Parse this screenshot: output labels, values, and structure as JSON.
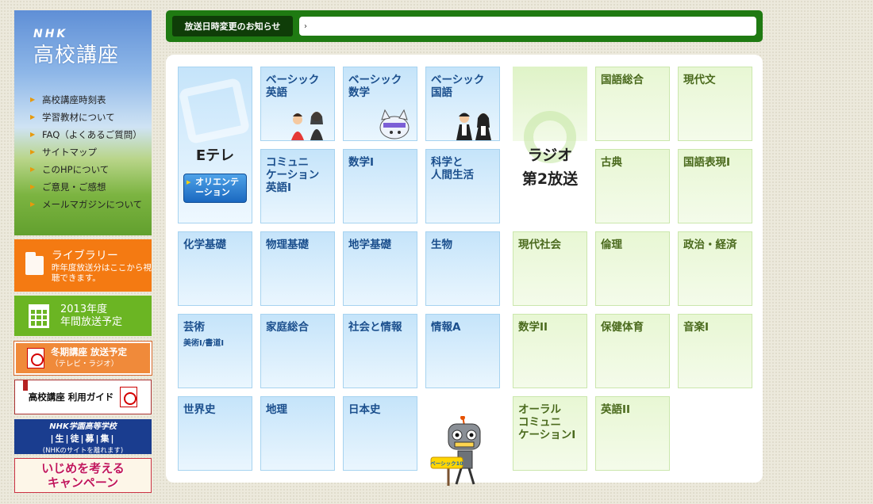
{
  "sidebar": {
    "logo_nhk": "NHK",
    "logo_title": "高校講座",
    "menu": [
      "高校講座時刻表",
      "学習教材について",
      "FAQ（よくあるご質問）",
      "サイトマップ",
      "このHPについて",
      "ご意見・ご感想",
      "メールマガジンについて"
    ],
    "library": {
      "title": "ライブラリー",
      "desc": "昨年度放送分はここから視聴できます。"
    },
    "schedule": {
      "line1": "2013年度",
      "line2": "年間放送予定"
    },
    "winter": {
      "line1": "冬期講座 放送予定",
      "line2": "（テレビ・ラジオ）"
    },
    "guide": "高校講座 利用ガイド",
    "gakuen": {
      "l1": "NHK学園高等学校",
      "l2": "|生|徒|募|集|",
      "l3": "(NHKのサイトを離れます)"
    },
    "ijime": {
      "line1": "いじめを考える",
      "line2": "キャンペーン"
    }
  },
  "notice": {
    "label": "放送日時変更のお知らせ",
    "text": "›"
  },
  "tv": {
    "title": "Eテレ",
    "orientation": "オリエンテーション",
    "tiles": [
      {
        "label": "ベーシック\n英語"
      },
      {
        "label": "ベーシック\n数学"
      },
      {
        "label": "ベーシック\n国語"
      },
      {
        "label": "コミュニ\nケーション\n英語I"
      },
      {
        "label": "数学I"
      },
      {
        "label": "科学と\n人間生活"
      },
      {
        "label": "化学基礎"
      },
      {
        "label": "物理基礎"
      },
      {
        "label": "地学基礎"
      },
      {
        "label": "生物"
      },
      {
        "label": "芸術",
        "sub": "美術I/書道I"
      },
      {
        "label": "家庭総合"
      },
      {
        "label": "社会と情報"
      },
      {
        "label": "情報A"
      },
      {
        "label": "世界史"
      },
      {
        "label": "地理"
      },
      {
        "label": "日本史"
      }
    ]
  },
  "radio": {
    "title": "ラジオ\n第2放送",
    "tiles": [
      {
        "label": "国語総合"
      },
      {
        "label": "現代文"
      },
      {
        "label": "古典"
      },
      {
        "label": "国語表現I"
      },
      {
        "label": "現代社会"
      },
      {
        "label": "倫理"
      },
      {
        "label": "政治・経済"
      },
      {
        "label": "数学II"
      },
      {
        "label": "保健体育"
      },
      {
        "label": "音楽I"
      },
      {
        "label": "オーラル\nコミュニ\nケーションI"
      },
      {
        "label": "英語II"
      }
    ]
  },
  "robot_sign": "ベーシック10"
}
